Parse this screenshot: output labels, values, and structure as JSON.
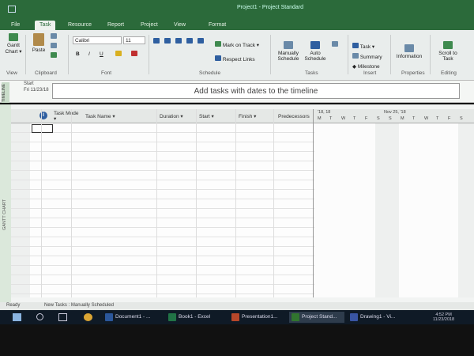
{
  "window": {
    "title": "Project1 - Project Standard"
  },
  "tabs": [
    "File",
    "Task",
    "Resource",
    "Report",
    "Project",
    "View",
    "Format"
  ],
  "ribbon": {
    "view_group": {
      "gantt_chart": "Gantt Chart ▾",
      "label": "View"
    },
    "clipboard_group": {
      "paste": "Paste",
      "label": "Clipboard"
    },
    "font_group": {
      "font_name": "Calibri",
      "font_size": "11",
      "bold": "B",
      "italic": "I",
      "underline": "U",
      "label": "Font"
    },
    "schedule_group": {
      "mark_on_track": "Mark on Track ▾",
      "respect_links": "Respect Links",
      "label": "Schedule"
    },
    "tasks_group": {
      "manually_schedule": "Manually Schedule",
      "auto_schedule": "Auto Schedule",
      "label": "Tasks"
    },
    "insert_group": {
      "task": "Task ▾",
      "summary": "Summary",
      "milestone": "Milestone",
      "label": "Insert"
    },
    "properties_group": {
      "information": "Information",
      "label": "Properties"
    },
    "editing_group": {
      "scroll_to_task": "Scroll to Task",
      "label": "Editing"
    }
  },
  "timeline": {
    "side_label": "TIMELINE",
    "start_label": "Start",
    "start_date": "Fri 11/23/18",
    "placeholder": "Add tasks with dates to the timeline"
  },
  "grid": {
    "columns": [
      "Task Mode ▾",
      "Task Name ▾",
      "Duration ▾",
      "Start ▾",
      "Finish ▾",
      "Predecessors"
    ],
    "side_label": "GANTT CHART"
  },
  "chart": {
    "weeks": [
      "'18, 18",
      "Nov 25, '18"
    ],
    "days": [
      "M",
      "T",
      "W",
      "T",
      "F",
      "S",
      "S",
      "M",
      "T",
      "W",
      "T",
      "F",
      "S"
    ]
  },
  "status": {
    "ready": "Ready",
    "new_tasks": "New Tasks : Manually Scheduled"
  },
  "taskbar": {
    "items": [
      {
        "label": "Document1 - ...",
        "color": "#2b579a"
      },
      {
        "label": "Book1 - Excel",
        "color": "#217346"
      },
      {
        "label": "Presentation1...",
        "color": "#b7472a"
      },
      {
        "label": "Project Stand...",
        "color": "#31752f"
      },
      {
        "label": "Drawing1 - Vi...",
        "color": "#3955a3"
      }
    ],
    "time": "4:52 PM",
    "date": "11/23/2018"
  }
}
